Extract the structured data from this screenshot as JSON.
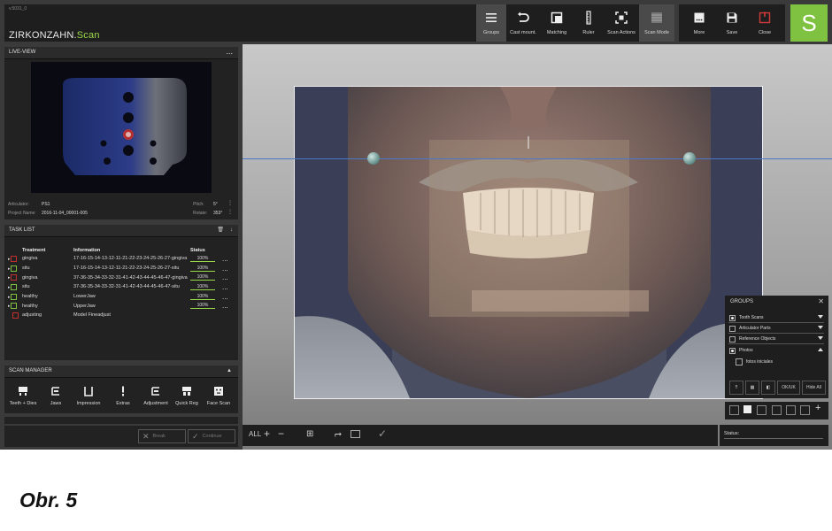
{
  "app": {
    "version": "v.5031_0",
    "logo_main": "ZIRKONZAHN.",
    "logo_scan": "Scan",
    "s_button": "S"
  },
  "toolbar": {
    "items": [
      {
        "label": "Groups",
        "icon": "menu-icon"
      },
      {
        "label": "Cast mount.",
        "icon": "undo-icon"
      },
      {
        "label": "Matching",
        "icon": "matching-icon"
      },
      {
        "label": "Ruler",
        "icon": "ruler-icon"
      },
      {
        "label": "Scan Actions",
        "icon": "scan-actions-icon"
      },
      {
        "label": "Scan Mode",
        "icon": "scan-mode-icon"
      }
    ],
    "right_items": [
      {
        "label": "More",
        "icon": "more-icon"
      },
      {
        "label": "Save",
        "icon": "save-icon"
      },
      {
        "label": "Close",
        "icon": "close-power-icon"
      }
    ]
  },
  "live_view": {
    "title": "LIVE-VIEW",
    "menu": "...",
    "articulator_label": "Articulator:",
    "articulator_value": "PS1",
    "project_label": "Project Name:",
    "project_value": "2016-11-04_00001-005",
    "pitch_label": "Pitch:",
    "pitch_value": "5°",
    "rotate_label": "Rotate:",
    "rotate_value": "353°"
  },
  "task_list": {
    "title": "TASK LIST",
    "columns": [
      "Treatment",
      "Information",
      "Status"
    ],
    "rows": [
      {
        "treatment": "gingiva",
        "information": "17-16-15-14-13-12-11-21-22-23-24-25-26-27-gingiva",
        "status": "100%"
      },
      {
        "treatment": "situ",
        "information": "17-16-15-14-13-12-11-21-22-23-24-25-26-27-situ",
        "status": "100%"
      },
      {
        "treatment": "gingiva",
        "information": "37-36-35-34-33-32-31-41-42-43-44-45-46-47-gingiva",
        "status": "100%"
      },
      {
        "treatment": "situ",
        "information": "37-36-35-34-33-32-31-41-42-43-44-45-46-47-situ",
        "status": "100%"
      },
      {
        "treatment": "healthy",
        "information": "LowerJaw",
        "status": "100%"
      },
      {
        "treatment": "healthy",
        "information": "UpperJaw",
        "status": "100%"
      },
      {
        "treatment": "adjusting",
        "information": "Model Fineadjust",
        "status": ""
      }
    ],
    "row_menu": "..."
  },
  "scan_manager": {
    "title": "SCAN MANAGER",
    "buttons": [
      {
        "label": "Teeth + Dies",
        "icon": "teeth-dies-icon"
      },
      {
        "label": "Jaws",
        "icon": "jaws-icon"
      },
      {
        "label": "Impression",
        "icon": "impression-icon"
      },
      {
        "label": "Extras",
        "icon": "extras-icon"
      },
      {
        "label": "Adjustment",
        "icon": "adjustment-icon"
      },
      {
        "label": "Quick Reg",
        "icon": "quick-reg-icon"
      },
      {
        "label": "Face Scan",
        "icon": "face-scan-icon"
      }
    ]
  },
  "actions": {
    "break_label": "Break",
    "continue_label": "Continue"
  },
  "groups": {
    "title": "GROUPS",
    "items": [
      {
        "label": "Tooth Scans",
        "checked": true,
        "expanded": false
      },
      {
        "label": "Articulator Parts",
        "checked": false,
        "expanded": false
      },
      {
        "label": "Reference Objects",
        "checked": false,
        "expanded": false
      },
      {
        "label": "Photos",
        "checked": true,
        "expanded": true
      }
    ],
    "sub_item": "fotos iniciales",
    "ok_label": "OK/UK",
    "hide_all_label": "Hide All"
  },
  "bottom_toolbar": {
    "all_label": "ALL"
  },
  "status_label": "Status:",
  "caption": "Obr. 5",
  "colors": {
    "accent_green": "#7fc241",
    "scan_text_green": "#9bd84a",
    "close_red": "#d23a3a",
    "horizontal_line": "#4a78c8"
  }
}
